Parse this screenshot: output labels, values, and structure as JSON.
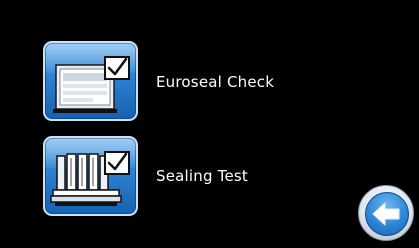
{
  "menu": {
    "items": [
      {
        "label": "Euroseal Check",
        "icon": "euroseal-check-icon"
      },
      {
        "label": "Sealing Test",
        "icon": "sealing-test-icon"
      }
    ]
  },
  "navigation": {
    "back_icon": "back-arrow-icon"
  },
  "colors": {
    "background": "#000000",
    "button_blue": "#2f84d3",
    "label_text": "#ffffff"
  }
}
